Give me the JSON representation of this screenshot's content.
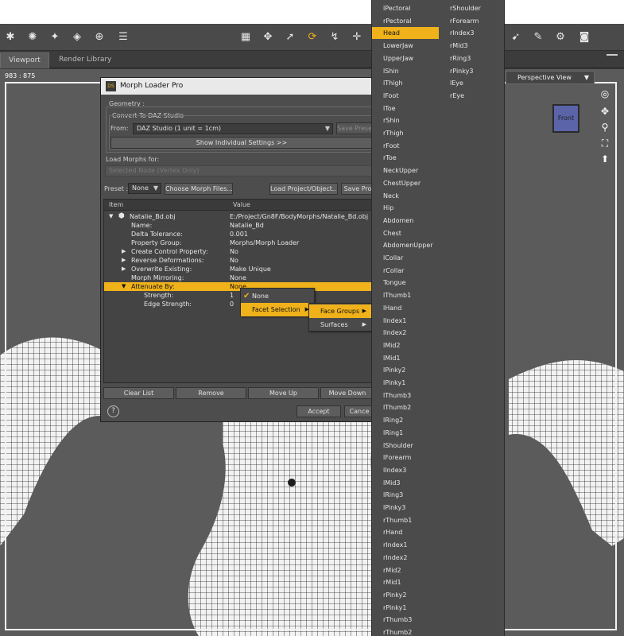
{
  "viewport": {
    "tab_active": "Viewport",
    "tab_inactive": "Render Library",
    "coordinates": "983 : 875",
    "view_mode": "Perspective View",
    "cube_label": "Front"
  },
  "dialog": {
    "title": "Morph Loader Pro",
    "logo_text": "DS",
    "geometry_label": "Geometry :",
    "convert_label": "Convert To DAZ Studio",
    "from_label": "From:",
    "from_value": "DAZ Studio (1 unit = 1cm)",
    "save_preset_label": "Save Prese",
    "show_settings_label": "Show Individual Settings >>",
    "load_morphs_label": "Load Morphs for:",
    "selected_node_label": "Selected Node (Vertex Only)",
    "preset_label": "Preset :",
    "preset_value": "None",
    "choose_files_label": "Choose Morph Files...",
    "load_project_label": "Load Project/Object...",
    "save_project_label": "Save Pro",
    "col_item": "Item",
    "col_value": "Value",
    "rows": [
      {
        "name": "Natalie_Bd.obj",
        "value": "E:/Project/Gn8F/BodyMorphs/Natalie_Bd.obj"
      },
      {
        "name": "Name:",
        "value": "Natalie_Bd"
      },
      {
        "name": "Delta Tolerance:",
        "value": "0.001"
      },
      {
        "name": "Property Group:",
        "value": "Morphs/Morph Loader"
      },
      {
        "name": "Create Control Property:",
        "value": "No"
      },
      {
        "name": "Reverse Deformations:",
        "value": "No"
      },
      {
        "name": "Overwrite Existing:",
        "value": "Make Unique"
      },
      {
        "name": "Morph Mirroring:",
        "value": "None"
      },
      {
        "name": "Attenuate By:",
        "value": "None"
      },
      {
        "name": "Strength:",
        "value": "1"
      },
      {
        "name": "Edge Strength:",
        "value": "0"
      }
    ],
    "clear_list": "Clear List",
    "remove": "Remove",
    "move_up": "Move Up",
    "move_down": "Move Down",
    "help": "?",
    "accept": "Accept",
    "cancel": "Cance"
  },
  "attenuate_menu": {
    "none": "None",
    "facet_selection": "Facet Selection"
  },
  "facet_menu": {
    "face_groups": "Face Groups",
    "surfaces": "Surfaces"
  },
  "face_groups": {
    "left_column": [
      "lPectoral",
      "rPectoral",
      "Head",
      "LowerJaw",
      "UpperJaw",
      "lShin",
      "lThigh",
      "lFoot",
      "lToe",
      "rShin",
      "rThigh",
      "rFoot",
      "rToe",
      "NeckUpper",
      "ChestUpper",
      "Neck",
      "Hip",
      "Abdomen",
      "Chest",
      "AbdomenUpper",
      "lCollar",
      "rCollar",
      "Tongue",
      "lThumb1",
      "lHand",
      "lIndex1",
      "lIndex2",
      "lMid2",
      "lMid1",
      "lPinky2",
      "lPinky1",
      "lThumb3",
      "lThumb2",
      "lRing2",
      "lRing1",
      "lShoulder",
      "lForearm",
      "lIndex3",
      "lMid3",
      "lRing3",
      "lPinky3",
      "rThumb1",
      "rHand",
      "rIndex1",
      "rIndex2",
      "rMid2",
      "rMid1",
      "rPinky2",
      "rPinky1",
      "rThumb3",
      "rThumb2"
    ],
    "right_column": [
      "rShoulder",
      "rForearm",
      "rIndex3",
      "rMid3",
      "rRing3",
      "rPinky3",
      "lEye",
      "rEye"
    ],
    "selected": "Head"
  },
  "colors": {
    "accent": "#f0b21a",
    "panel": "#4d4d4d",
    "viewport": "#5b5b5b"
  }
}
